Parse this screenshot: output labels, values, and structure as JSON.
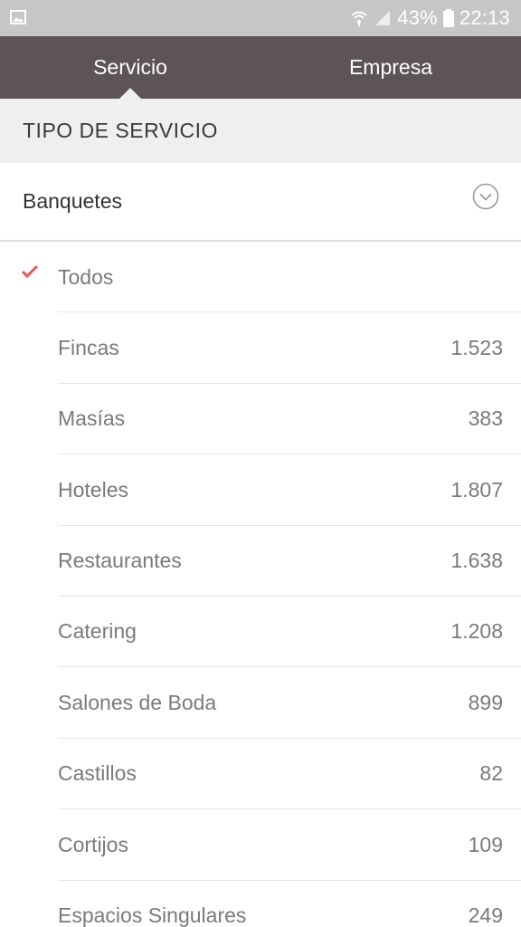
{
  "status_bar": {
    "battery_percent": "43%",
    "time": "22:13",
    "icons": [
      "image-notification-icon",
      "wifi-icon",
      "signal-icon",
      "battery-icon"
    ]
  },
  "tabs": [
    {
      "label": "Servicio",
      "selected": true
    },
    {
      "label": "Empresa",
      "selected": false
    }
  ],
  "section": {
    "title": "TIPO DE SERVICIO"
  },
  "dropdown": {
    "value": "Banquetes",
    "icon": "chevron-down-circle-icon"
  },
  "list": {
    "items": [
      {
        "label": "Todos",
        "count": "",
        "checked": true
      },
      {
        "label": "Fincas",
        "count": "1.523"
      },
      {
        "label": "Masías",
        "count": "383"
      },
      {
        "label": "Hoteles",
        "count": "1.807"
      },
      {
        "label": "Restaurantes",
        "count": "1.638"
      },
      {
        "label": "Catering",
        "count": "1.208"
      },
      {
        "label": "Salones de Boda",
        "count": "899"
      },
      {
        "label": "Castillos",
        "count": "82"
      },
      {
        "label": "Cortijos",
        "count": "109"
      },
      {
        "label": "Espacios Singulares",
        "count": "249"
      }
    ]
  },
  "colors": {
    "status_bar": "#c6c6c6",
    "tab_bar": "#5c5455",
    "section_bg": "#efefef",
    "check": "#e0585a",
    "text_muted": "#7a7a7a"
  }
}
